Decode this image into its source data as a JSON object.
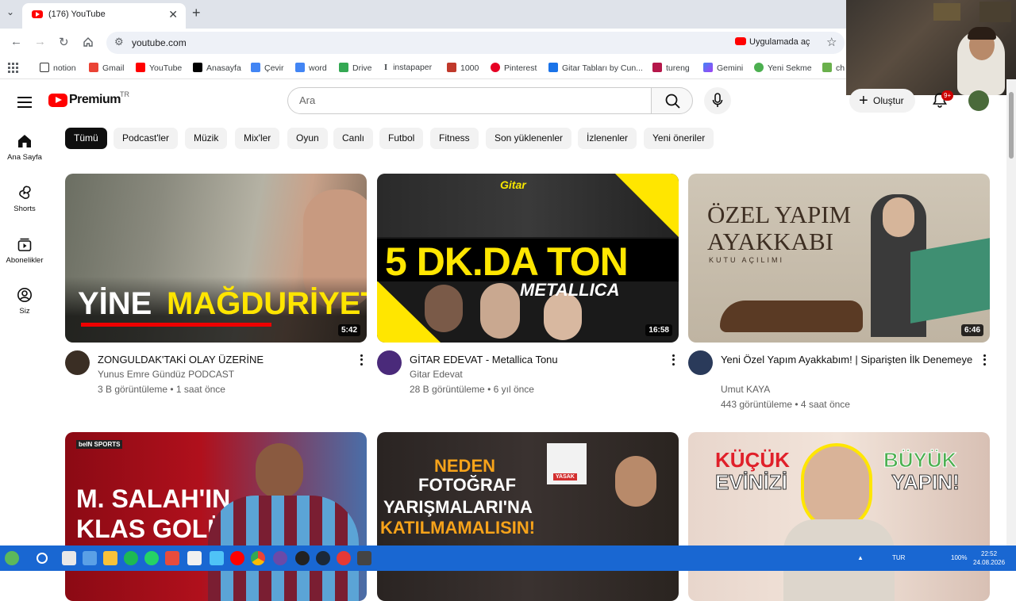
{
  "browser": {
    "tab_title": "(176) YouTube",
    "url": "youtube.com",
    "open_in_app": "Uygulamada aç",
    "bookmarks": [
      "notion",
      "Gmail",
      "YouTube",
      "Anasayfa",
      "Çevir",
      "word",
      "Drive",
      "instapaper",
      "1000",
      "Pinterest",
      "Gitar Tabları by Cun...",
      "tureng",
      "Gemini",
      "Yeni Sekme",
      "ch"
    ]
  },
  "youtube": {
    "logo_text": "Premium",
    "country_code": "TR",
    "search_placeholder": "Ara",
    "create_label": "Oluştur",
    "notification_count": "9+"
  },
  "sidebar": [
    {
      "label": "Ana Sayfa",
      "icon": "home-icon"
    },
    {
      "label": "Shorts",
      "icon": "shorts-icon"
    },
    {
      "label": "Abonelikler",
      "icon": "subscriptions-icon"
    },
    {
      "label": "Siz",
      "icon": "you-icon"
    }
  ],
  "chips": [
    "Tümü",
    "Podcast'ler",
    "Müzik",
    "Mix'ler",
    "Oyun",
    "Canlı",
    "Futbol",
    "Fitness",
    "Son yüklenenler",
    "İzlenenler",
    "Yeni öneriler"
  ],
  "videos": [
    {
      "title": "ZONGULDAK'TAKİ OLAY ÜZERİNE",
      "channel": "Yunus Emre Gündüz PODCAST",
      "stats": "3 B görüntüleme • 1 saat önce",
      "duration": "5:42",
      "thumb_text_1": "YİNE",
      "thumb_text_2": "MAĞDURİYET"
    },
    {
      "title": "GİTAR EDEVAT - Metallica Tonu",
      "channel": "Gitar Edevat",
      "stats": "28 B görüntüleme • 6 yıl önce",
      "duration": "16:58",
      "thumb_text_1": "5 DK.DA TON",
      "thumb_text_2": "METALLICA",
      "thumb_text_3": "Gitar"
    },
    {
      "title": "Yeni Özel Yapım Ayakkabım! | Siparişten İlk Denemeye",
      "channel": "Umut KAYA",
      "stats": "443 görüntüleme • 4 saat önce",
      "duration": "6:46",
      "thumb_text_1": "ÖZEL YAPIM",
      "thumb_text_2": "AYAKKABI",
      "thumb_text_3": "KUTU AÇILIMI"
    },
    {
      "thumb_text_1": "M. SALAH'IN",
      "thumb_text_2": "KLAS GOLÜ!",
      "thumb_text_3": "beIN SPORTS"
    },
    {
      "thumb_text_1": "NEDEN",
      "thumb_text_2": "FOTOĞRAF",
      "thumb_text_3": "YARIŞMALARI'NA",
      "thumb_text_4": "KATILMAMALISIN!",
      "thumb_text_5": "YASAK"
    },
    {
      "thumb_text_1": "KÜÇÜK",
      "thumb_text_2": "EVİNİZİ",
      "thumb_text_3": "BÜYÜK",
      "thumb_text_4": "YAPIN!"
    }
  ],
  "taskbar": {
    "time": "22:52",
    "date": "24.08.2026",
    "lang": "TUR",
    "battery": "100%"
  }
}
